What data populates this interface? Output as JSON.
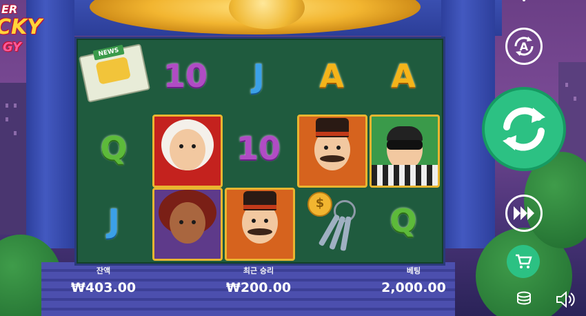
{
  "game": {
    "logo_lines": [
      "ER",
      "CKY",
      "GY"
    ],
    "accent_color": "#2cc183"
  },
  "reels": {
    "columns": 5,
    "rows": 3,
    "symbols": [
      [
        "newspaper",
        "Q",
        "J"
      ],
      [
        "10",
        "blonde-woman",
        "curly-hair-woman"
      ],
      [
        "J",
        "10",
        "mustache-man"
      ],
      [
        "A",
        "mustache-man",
        "keys"
      ],
      [
        "A",
        "robber",
        "Q"
      ]
    ],
    "labels": {
      "ten": "10",
      "jack": "J",
      "ace": "A",
      "queen": "Q",
      "news": "NEWS",
      "coin": "$"
    }
  },
  "controls": {
    "auto_icon": "autoplay-icon",
    "auto_label": "A",
    "spin_icon": "spin-icon",
    "turbo_icon": "turbo-icon",
    "shop_icon": "cart-icon",
    "coins_icon": "coins-icon",
    "sound_icon": "sound-icon",
    "menu_icon": "menu-icon"
  },
  "footer": {
    "balance_label": "잔액",
    "balance_value": "₩403.00",
    "last_win_label": "최근 승리",
    "last_win_value": "₩200.00",
    "bet_label": "베팅",
    "bet_value": "2,000.00"
  }
}
